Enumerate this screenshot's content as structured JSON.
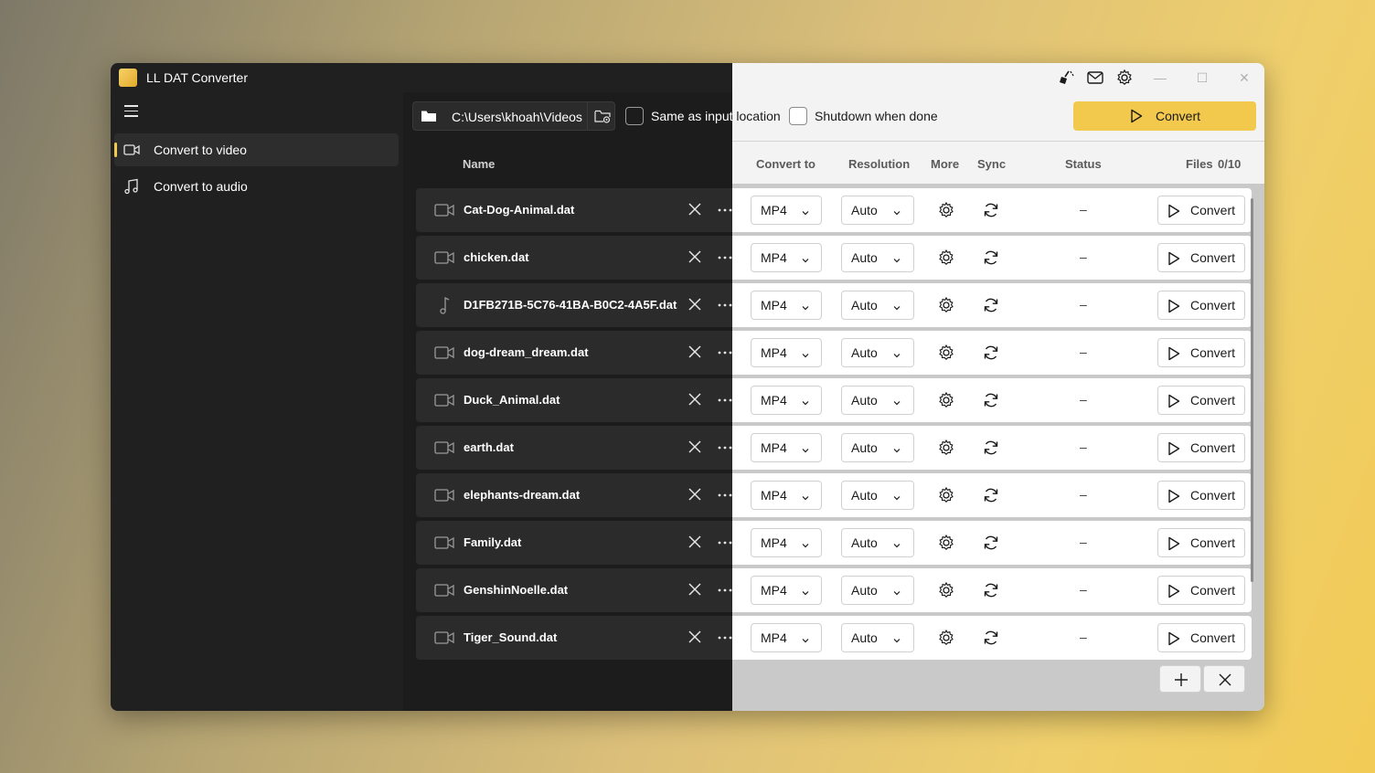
{
  "window": {
    "title": "LL DAT Converter"
  },
  "titlebar": {
    "icons": [
      "broom-icon",
      "mail-icon",
      "gear-icon"
    ],
    "controls": [
      "minimize-icon",
      "maximize-icon",
      "close-icon"
    ]
  },
  "sidebar": {
    "items": [
      {
        "label": "Convert to video",
        "icon": "video-icon",
        "active": true
      },
      {
        "label": "Convert to audio",
        "icon": "music-note-icon",
        "active": false
      }
    ]
  },
  "toolbar": {
    "output_path": "C:\\Users\\khoah\\Videos",
    "same_as_input_label": "Same as input location",
    "same_as_input_checked": false,
    "shutdown_label": "Shutdown when done",
    "shutdown_checked": false,
    "convert_all_label": "Convert"
  },
  "table": {
    "headers": {
      "name": "Name",
      "convert_to": "Convert to",
      "resolution": "Resolution",
      "more": "More",
      "sync": "Sync",
      "status": "Status",
      "files": "Files",
      "files_count": "0/10"
    },
    "rows": [
      {
        "name": "Cat-Dog-Animal.dat",
        "type": "video",
        "format": "MP4",
        "resolution": "Auto",
        "status": "–",
        "convert_label": "Convert"
      },
      {
        "name": "chicken.dat",
        "type": "video",
        "format": "MP4",
        "resolution": "Auto",
        "status": "–",
        "convert_label": "Convert"
      },
      {
        "name": "D1FB271B-5C76-41BA-B0C2-4A5F.dat",
        "type": "audio",
        "format": "MP4",
        "resolution": "Auto",
        "status": "–",
        "convert_label": "Convert"
      },
      {
        "name": "dog-dream_dream.dat",
        "type": "video",
        "format": "MP4",
        "resolution": "Auto",
        "status": "–",
        "convert_label": "Convert"
      },
      {
        "name": "Duck_Animal.dat",
        "type": "video",
        "format": "MP4",
        "resolution": "Auto",
        "status": "–",
        "convert_label": "Convert"
      },
      {
        "name": "earth.dat",
        "type": "video",
        "format": "MP4",
        "resolution": "Auto",
        "status": "–",
        "convert_label": "Convert"
      },
      {
        "name": "elephants-dream.dat",
        "type": "video",
        "format": "MP4",
        "resolution": "Auto",
        "status": "–",
        "convert_label": "Convert"
      },
      {
        "name": "Family.dat",
        "type": "video",
        "format": "MP4",
        "resolution": "Auto",
        "status": "–",
        "convert_label": "Convert"
      },
      {
        "name": "GenshinNoelle.dat",
        "type": "video",
        "format": "MP4",
        "resolution": "Auto",
        "status": "–",
        "convert_label": "Convert"
      },
      {
        "name": "Tiger_Sound.dat",
        "type": "video",
        "format": "MP4",
        "resolution": "Auto",
        "status": "–",
        "convert_label": "Convert"
      }
    ]
  },
  "footer": {
    "buttons": [
      "add-icon",
      "clear-icon"
    ]
  },
  "colors": {
    "accent": "#f2c94c",
    "dark_bg": "#202020",
    "light_bg": "#f3f3f3"
  }
}
